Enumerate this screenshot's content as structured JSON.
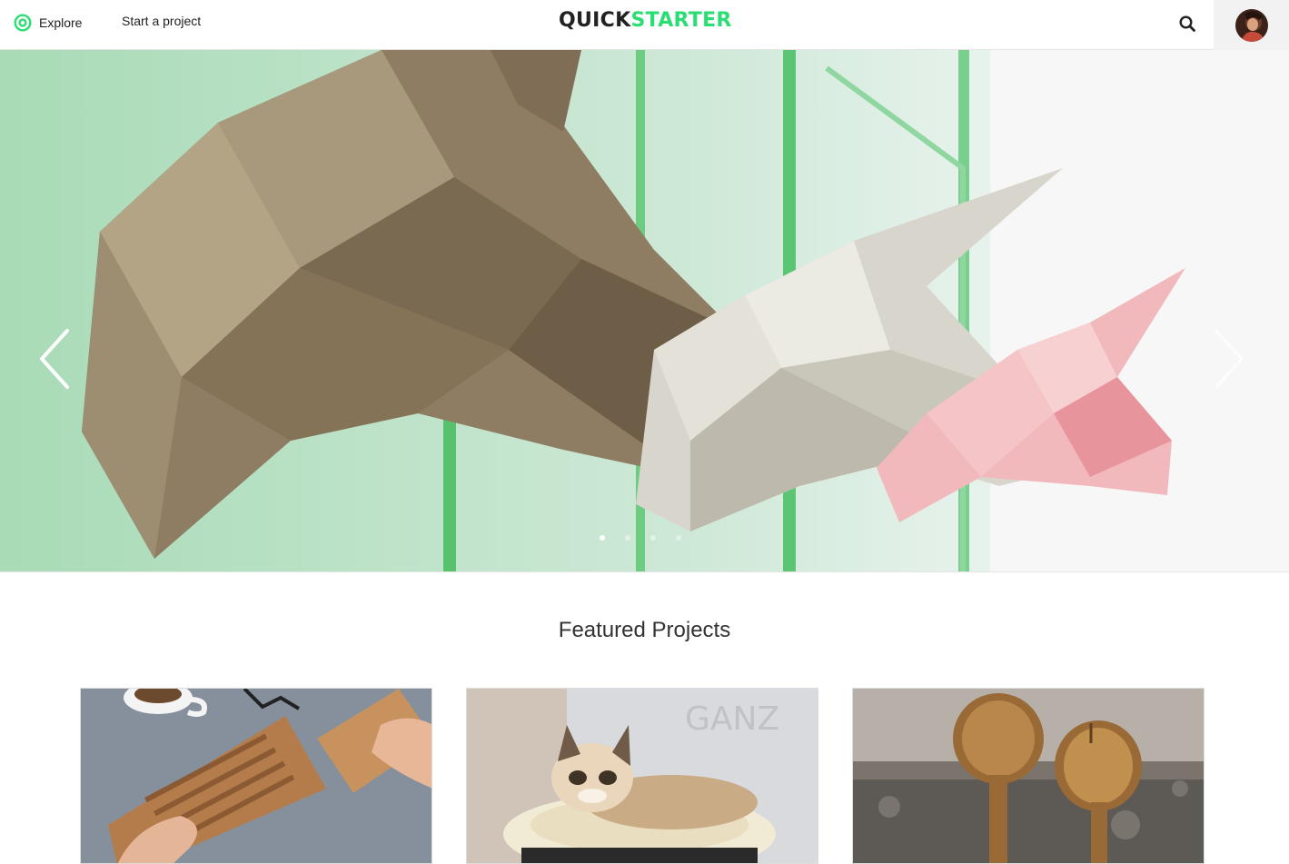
{
  "header": {
    "explore_label": "Explore",
    "start_project_label": "Start a project",
    "logo_part1": "QUICK",
    "logo_part2": "STARTER"
  },
  "hero": {
    "slide_count": 4,
    "active_slide": 1
  },
  "featured": {
    "title": "Featured Projects",
    "cards": [
      {
        "image": "wooden-keyboard-photo"
      },
      {
        "image": "grumpy-cat-photo"
      },
      {
        "image": "wooden-spoons-photo"
      }
    ]
  },
  "colors": {
    "brand_green": "#2bde73",
    "text_dark": "#222222"
  },
  "icons": {
    "explore": "compass-icon",
    "search": "search-icon",
    "prev": "chevron-left-icon",
    "next": "chevron-right-icon"
  }
}
